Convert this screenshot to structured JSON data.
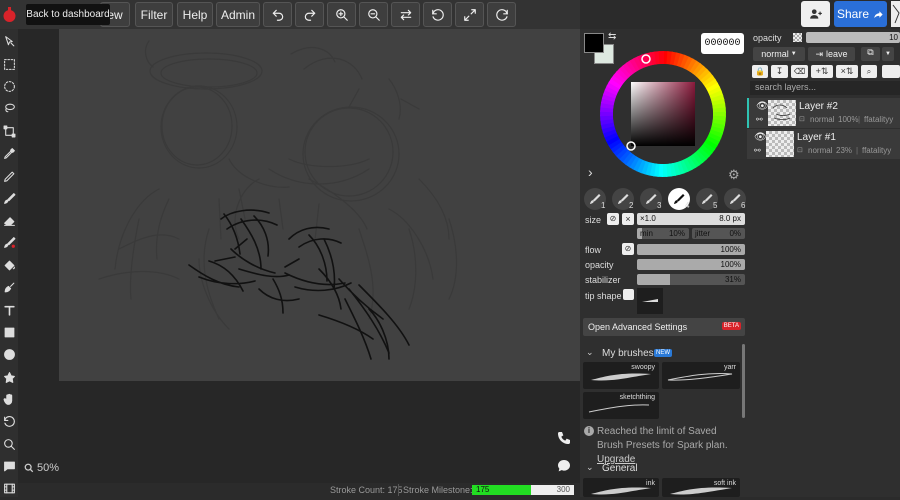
{
  "topbar": {
    "view_partial": "ew",
    "filter": "Filter",
    "help": "Help",
    "admin": "Admin",
    "tooltip": "Back to dashboard"
  },
  "canvas": {
    "zoom": "50%"
  },
  "status": {
    "stroke_count_label": "Stroke Count: 175",
    "stroke_milestone_label": "Stroke Milestone:",
    "milestone_current": "175",
    "milestone_target": "300",
    "milestone_progress": 0.583
  },
  "color": {
    "hex_value": "000000",
    "primary": "#000000",
    "secondary": "#dde8e0",
    "picked_hue": "#8b1a3c"
  },
  "brush": {
    "slots": [
      "1",
      "2",
      "3",
      "4",
      "5",
      "6"
    ],
    "active_slot": 3,
    "size_label": "size",
    "size_multiplier": "×1.0",
    "size_value": "8.0 px",
    "min_label": "min",
    "min_value": "10%",
    "min_progress": 0.1,
    "jitter_label": "jitter",
    "jitter_value": "0%",
    "jitter_progress": 0.0,
    "flow_label": "flow",
    "flow_value": "100%",
    "flow_progress": 1.0,
    "opacity_label": "opacity",
    "opacity_value": "100%",
    "opacity_progress": 1.0,
    "stabilizer_label": "stabilizer",
    "stabilizer_value": "31%",
    "stabilizer_progress": 0.31,
    "tip_shape_label": "tip shape",
    "advanced_label": "Open Advanced Settings",
    "beta_badge": "BETA"
  },
  "my_brushes": {
    "title": "My brushes",
    "badge": "NEW",
    "items": [
      "swoopy",
      "yarr",
      "sketchthing"
    ],
    "limit_notice": "Reached the limit of Saved Brush Presets for Spark plan.",
    "upgrade_link": "Upgrade"
  },
  "general": {
    "title": "General",
    "items": [
      "ink",
      "soft ink"
    ]
  },
  "share": {
    "label": "Share"
  },
  "layers": {
    "opacity_label": "opacity",
    "opacity_value": "10",
    "blend_mode": "normal",
    "leave_label": "leave",
    "search_placeholder": "search layers...",
    "items": [
      {
        "name": "Layer #2",
        "meta_mode": "normal",
        "meta_opacity": "100%",
        "meta_user": "ffatalityy"
      },
      {
        "name": "Layer #1",
        "meta_mode": "normal",
        "meta_opacity": "23%",
        "meta_user": "ffatalityy"
      }
    ]
  }
}
